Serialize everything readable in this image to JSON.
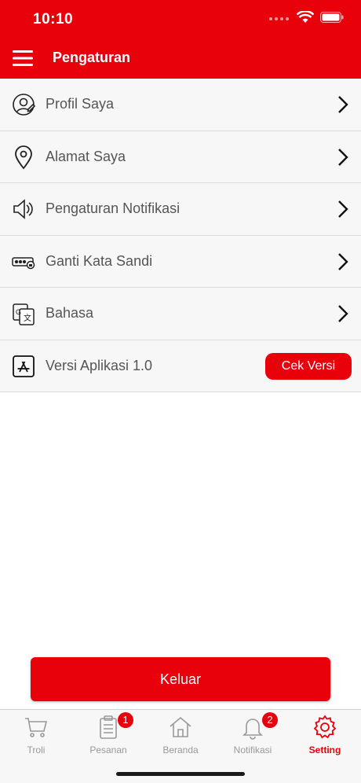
{
  "status_bar": {
    "time": "10:10"
  },
  "header": {
    "title": "Pengaturan"
  },
  "settings": {
    "items": [
      {
        "label": "Profil Saya",
        "icon": "profile-icon"
      },
      {
        "label": "Alamat Saya",
        "icon": "location-pin-icon"
      },
      {
        "label": "Pengaturan Notifikasi",
        "icon": "speaker-icon"
      },
      {
        "label": "Ganti Kata Sandi",
        "icon": "password-icon"
      },
      {
        "label": "Bahasa",
        "icon": "translate-icon"
      }
    ],
    "version": {
      "label": "Versi Aplikasi 1.0",
      "button_label": "Cek Versi",
      "icon": "app-store-icon"
    }
  },
  "logout_label": "Keluar",
  "tabs": [
    {
      "label": "Troli",
      "icon": "cart-icon",
      "active": false
    },
    {
      "label": "Pesanan",
      "icon": "clipboard-icon",
      "badge": "1",
      "active": false
    },
    {
      "label": "Beranda",
      "icon": "home-icon",
      "active": false
    },
    {
      "label": "Notifikasi",
      "icon": "bell-icon",
      "badge": "2",
      "active": false
    },
    {
      "label": "Setting",
      "icon": "gear-icon",
      "active": true
    }
  ],
  "colors": {
    "brand": "#e8000b",
    "text": "#555555",
    "tab_inactive": "#999999"
  }
}
